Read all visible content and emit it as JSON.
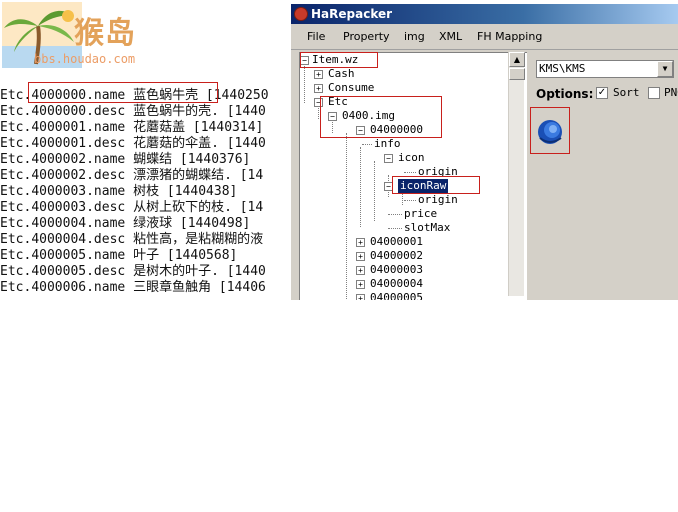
{
  "watermark": {
    "brand_text": "猴岛",
    "url": "bbs.houdao.com"
  },
  "text_lines": [
    {
      "prefix": "Etc.",
      "key": "4000000.name",
      "value": "蓝色蜗牛壳",
      "extra": " [1440250"
    },
    {
      "prefix": "Etc.",
      "key": "4000000.desc",
      "value": "蓝色蜗牛的壳.",
      "extra": " [1440"
    },
    {
      "prefix": "Etc.",
      "key": "4000001.name",
      "value": "花蘑菇盖",
      "extra": " [1440314]"
    },
    {
      "prefix": "Etc.",
      "key": "4000001.desc",
      "value": "花蘑菇的伞盖.",
      "extra": " [1440"
    },
    {
      "prefix": "Etc.",
      "key": "4000002.name",
      "value": "蝴蝶结",
      "extra": " [1440376]"
    },
    {
      "prefix": "Etc.",
      "key": "4000002.desc",
      "value": "漂漂猪的蝴蝶结.",
      "extra": " [14"
    },
    {
      "prefix": "Etc.",
      "key": "4000003.name",
      "value": "树枝",
      "extra": " [1440438]"
    },
    {
      "prefix": "Etc.",
      "key": "4000003.desc",
      "value": "从树上砍下的枝.",
      "extra": " [14"
    },
    {
      "prefix": "Etc.",
      "key": "4000004.name",
      "value": "绿液球",
      "extra": " [1440498]"
    },
    {
      "prefix": "Etc.",
      "key": "4000004.desc",
      "value": "粘性高，是粘糊糊的液",
      "extra": ""
    },
    {
      "prefix": "Etc.",
      "key": "4000005.name",
      "value": "叶子",
      "extra": " [1440568]"
    },
    {
      "prefix": "Etc.",
      "key": "4000005.desc",
      "value": "是树木的叶子.",
      "extra": " [1440"
    },
    {
      "prefix": "Etc.",
      "key": "4000006.name",
      "value": "三眼章鱼触角",
      "extra": " [14406"
    }
  ],
  "window": {
    "title": "HaRepacker",
    "menu": [
      "File",
      "Property",
      "img",
      "XML",
      "FH Mapping"
    ]
  },
  "tree": {
    "root": "Item.wz",
    "cash": "Cash",
    "consume": "Consume",
    "etc": "Etc",
    "img": "0400.img",
    "item": "04000000",
    "info": "info",
    "icon": "icon",
    "origin": "origin",
    "iconRaw": "iconRaw",
    "origin2": "origin",
    "price": "price",
    "slotMax": "slotMax",
    "siblings": [
      "04000001",
      "04000002",
      "04000003",
      "04000004",
      "04000005"
    ]
  },
  "right_pane": {
    "region": "KMS\\KMS",
    "options_label": "Options:",
    "sort_label": "Sort",
    "sort_checked": "✓",
    "png_label": "PNG"
  },
  "colors": {
    "highlight_box": "#c8201c",
    "selection": "#0a246a",
    "titlebar": "#0a246a"
  }
}
